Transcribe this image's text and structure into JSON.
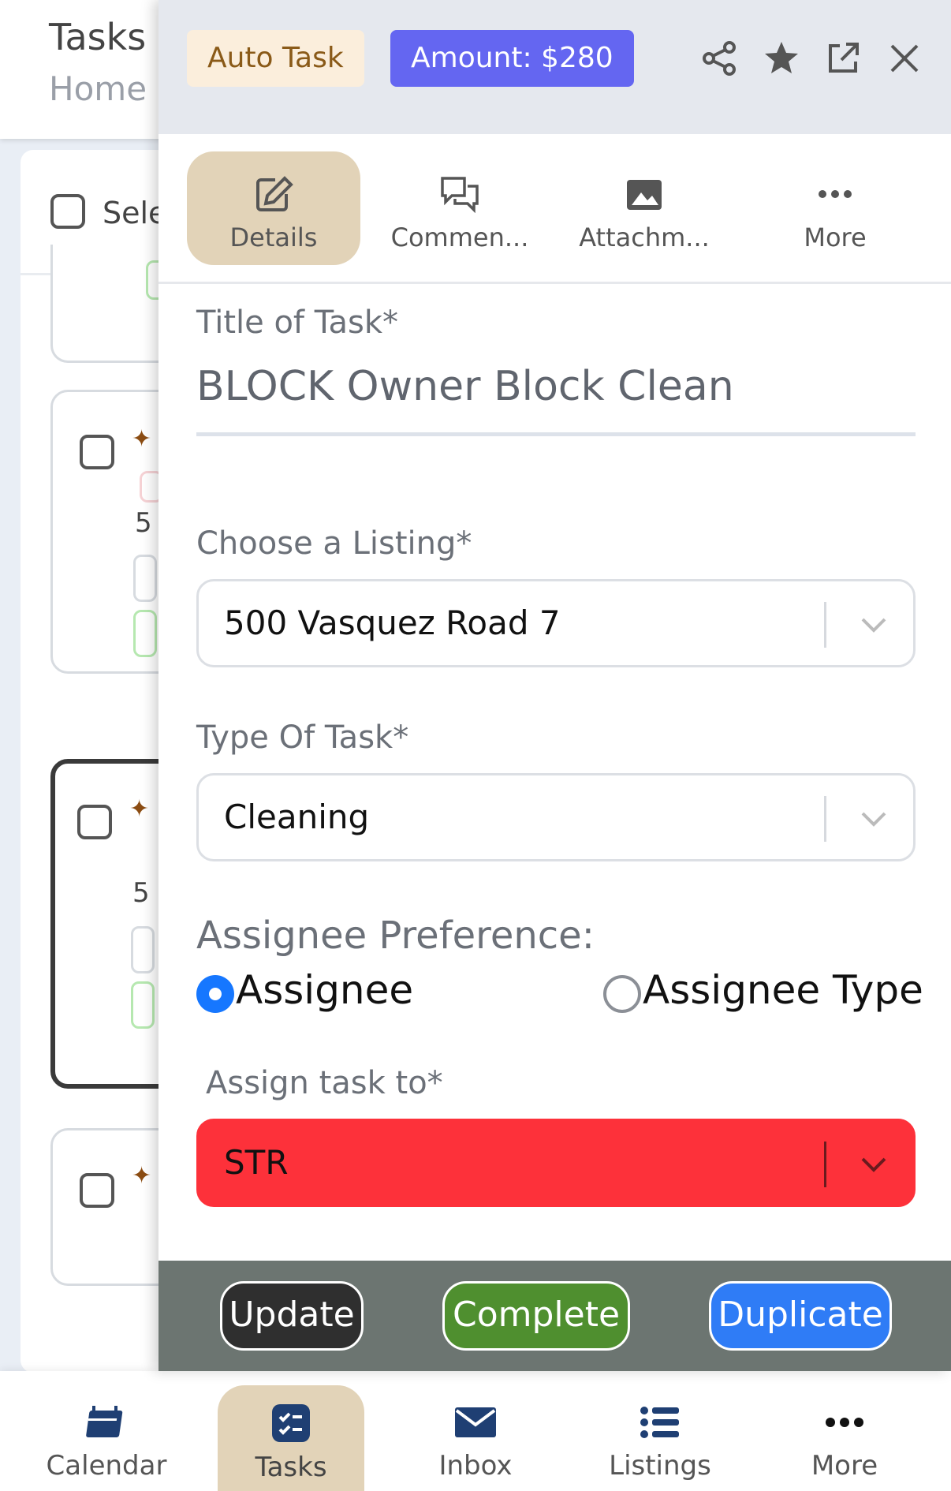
{
  "background": {
    "header": {
      "title": "Tasks",
      "subtitle": "Home"
    },
    "select_all_label": "Sele",
    "card_digit": "5"
  },
  "drawer": {
    "badges": {
      "auto_task": "Auto Task",
      "amount": "Amount: $280"
    },
    "header_icons": [
      "share-icon",
      "star-icon",
      "open-external-icon",
      "close-icon"
    ],
    "tabs": [
      {
        "label": "Details",
        "icon": "edit-icon",
        "active": true
      },
      {
        "label": "Commen...",
        "icon": "comments-icon",
        "active": false
      },
      {
        "label": "Attachm...",
        "icon": "image-icon",
        "active": false
      },
      {
        "label": "More",
        "icon": "more-icon",
        "active": false
      }
    ],
    "form": {
      "title_label": "Title of Task*",
      "title_value": "BLOCK Owner Block Clean",
      "listing_label": "Choose a Listing*",
      "listing_value": "500 Vasquez Road 7",
      "type_label": "Type Of Task*",
      "type_value": "Cleaning",
      "pref_label": "Assignee Preference:",
      "radio_assignee": "Assignee",
      "radio_assignee_type": "Assignee Type",
      "selected_preference": "Assignee",
      "assign_label": "Assign task to*",
      "assign_value": "STR"
    },
    "actions": {
      "update": "Update",
      "complete": "Complete",
      "duplicate": "Duplicate"
    }
  },
  "bottom_nav": {
    "items": [
      {
        "label": "Calendar",
        "icon": "calendar-icon"
      },
      {
        "label": "Tasks",
        "icon": "tasks-icon",
        "active": true
      },
      {
        "label": "Inbox",
        "icon": "inbox-icon"
      },
      {
        "label": "Listings",
        "icon": "listings-icon"
      },
      {
        "label": "More",
        "icon": "more-icon"
      }
    ]
  },
  "colors": {
    "accent_tan": "#e2d3b8",
    "amount_badge": "#6466f1",
    "danger": "#fd313a",
    "update_btn": "#2f2f2f",
    "complete_btn": "#4f8f2f",
    "duplicate_btn": "#2f7cf6",
    "action_bar": "#6c7571"
  }
}
